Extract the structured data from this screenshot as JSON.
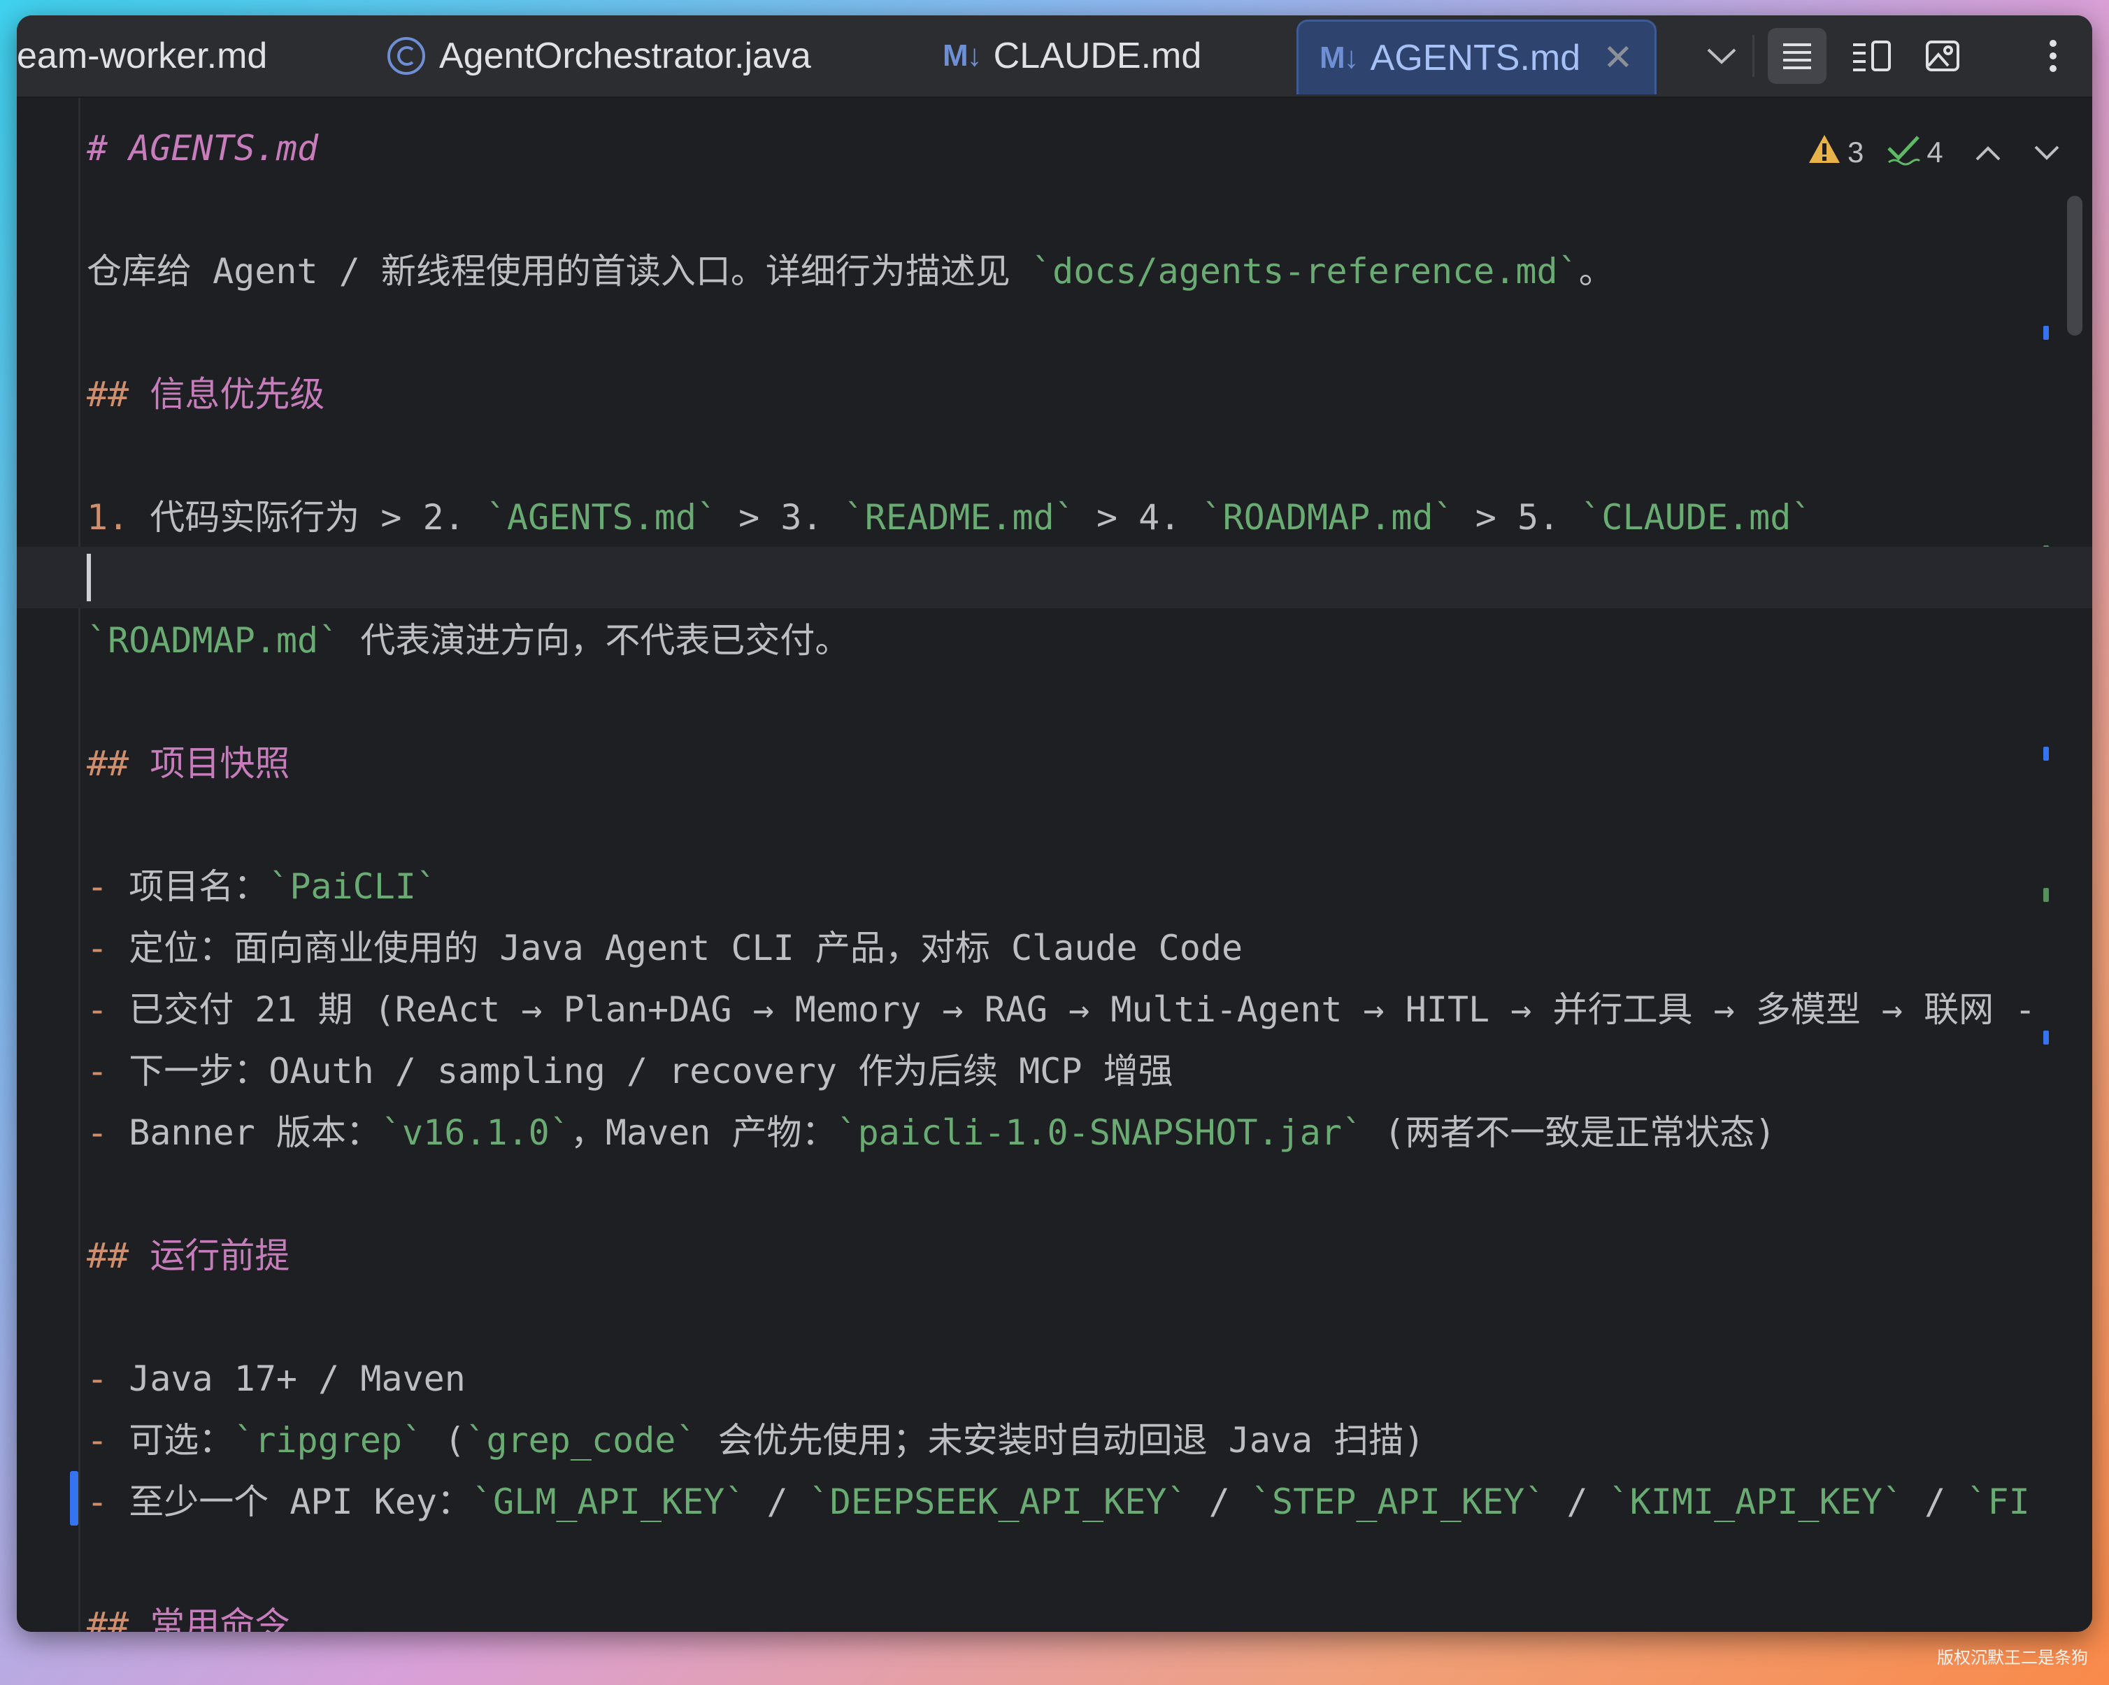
{
  "tabs": [
    {
      "label": "eam-worker.md",
      "icon": "markdown-icon"
    },
    {
      "label": "AgentOrchestrator.java",
      "icon": "java-class-icon"
    },
    {
      "label": "CLAUDE.md",
      "icon": "markdown-icon"
    },
    {
      "label": "AGENTS.md",
      "icon": "markdown-icon",
      "active": true
    }
  ],
  "md_icon_text": "M↓",
  "close_glyph": "✕",
  "inspections": {
    "warnings": "3",
    "weak_warnings": "4"
  },
  "lines": {
    "l1": "AGENTS.md",
    "l3a": "仓库给 Agent / 新线程使用的首读入口。详细行为描述见 ",
    "l3b": "`docs/agents-reference.md`",
    "l3c": "。",
    "l5": "信息优先级",
    "l7a": "1.",
    "l7b": " 代码实际行为 > 2. ",
    "l7c": "`AGENTS.md`",
    "l7d": " > 3. ",
    "l7e": "`README.md`",
    "l7f": " > 4. ",
    "l7g": "`ROADMAP.md`",
    "l7h": " > 5. ",
    "l7i": "`CLAUDE.md`",
    "l9a": "`ROADMAP.md`",
    "l9b": " 代表演进方向，不代表已交付。",
    "l11": "项目快照",
    "l13a": " 项目名：",
    "l13b": "`PaiCLI`",
    "l14": " 定位：面向商业使用的 Java Agent CLI 产品，对标 Claude Code",
    "l15": " 已交付 21 期 (ReAct → Plan+DAG → Memory → RAG → Multi-Agent → HITL → 并行工具 → 多模型 → 联网 -",
    "l16": " 下一步：OAuth / sampling / recovery 作为后续 MCP 增强",
    "l17a": " Banner 版本：",
    "l17b": "`v16.1.0`",
    "l17c": "，Maven 产物：",
    "l17d": "`paicli-1.0-SNAPSHOT.jar`",
    "l17e": " (两者不一致是正常状态)",
    "l19": "运行前提",
    "l21": " Java 17+ / Maven",
    "l22a": " 可选：",
    "l22b": "`ripgrep`",
    "l22c": " (",
    "l22d": "`grep_code`",
    "l22e": " 会优先使用；未安装时自动回退 Java 扫描)",
    "l23a": " 至少一个 API Key：",
    "l23b": "`GLM_API_KEY`",
    "l23c": " / ",
    "l23d": "`DEEPSEEK_API_KEY`",
    "l23e": " / ",
    "l23f": "`STEP_API_KEY`",
    "l23g": " / ",
    "l23h": "`KIMI_API_KEY`",
    "l23i": " / ",
    "l23j": "`FI",
    "l25": "常用命令"
  },
  "markers": {
    "h1": "#",
    "h2": "##",
    "bullet": "-"
  },
  "watermark": "版权沉默王二是条狗"
}
